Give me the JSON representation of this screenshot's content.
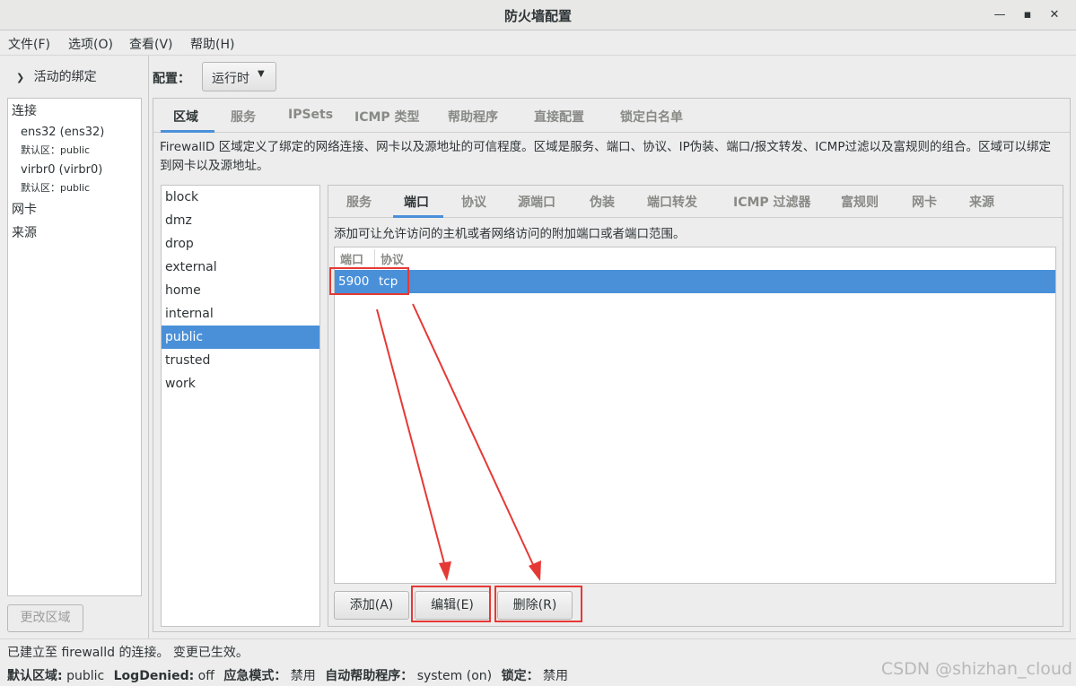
{
  "window": {
    "title": "防火墙配置"
  },
  "menu": [
    "文件(F)",
    "选项(O)",
    "查看(V)",
    "帮助(H)"
  ],
  "bindings": {
    "header": "活动的绑定",
    "connections_label": "连接",
    "connections": [
      {
        "name": "ens32 (ens32)",
        "default_zone": "默认区：public"
      },
      {
        "name": "virbr0 (virbr0)",
        "default_zone": "默认区：public"
      }
    ],
    "nic_label": "网卡",
    "source_label": "来源",
    "change_zone_button": "更改区域"
  },
  "config": {
    "label": "配置：",
    "mode": "运行时"
  },
  "top_tabs": [
    "区域",
    "服务",
    "IPSets",
    "ICMP 类型",
    "帮助程序",
    "直接配置",
    "锁定白名单"
  ],
  "zones_description": "FirewallD 区域定义了绑定的网络连接、网卡以及源地址的可信程度。区域是服务、端口、协议、IP伪装、端口/报文转发、ICMP过滤以及富规则的组合。区域可以绑定到网卡以及源地址。",
  "zones": [
    "block",
    "dmz",
    "drop",
    "external",
    "home",
    "internal",
    "public",
    "trusted",
    "work"
  ],
  "selected_zone": "public",
  "zone_tabs": [
    "服务",
    "端口",
    "协议",
    "源端口",
    "伪装",
    "端口转发",
    "ICMP 过滤器",
    "富规则",
    "网卡",
    "来源"
  ],
  "ports_description": "添加可让允许访问的主机或者网络访问的附加端口或者端口范围。",
  "ports_table": {
    "headers": [
      "端口",
      "协议"
    ],
    "rows": [
      {
        "port": "5900",
        "protocol": "tcp"
      }
    ]
  },
  "port_buttons": {
    "add": "添加(A)",
    "edit": "编辑(E)",
    "remove": "删除(R)"
  },
  "status": {
    "message": "已建立至  firewalld 的连接。 变更已生效。",
    "default_zone_label": "默认区域:",
    "default_zone_value": "public",
    "logdenied_label": "LogDenied:",
    "logdenied_value": "off",
    "panic_label": "应急模式：",
    "panic_value": "禁用",
    "autohelpers_label": "自动帮助程序：",
    "autohelpers_value": "system (on)",
    "lockdown_label": "锁定：",
    "lockdown_value": "禁用"
  },
  "watermark": "CSDN @shizhan_cloud",
  "annotation_color": "#e53935",
  "accent_color": "#4a90d9"
}
